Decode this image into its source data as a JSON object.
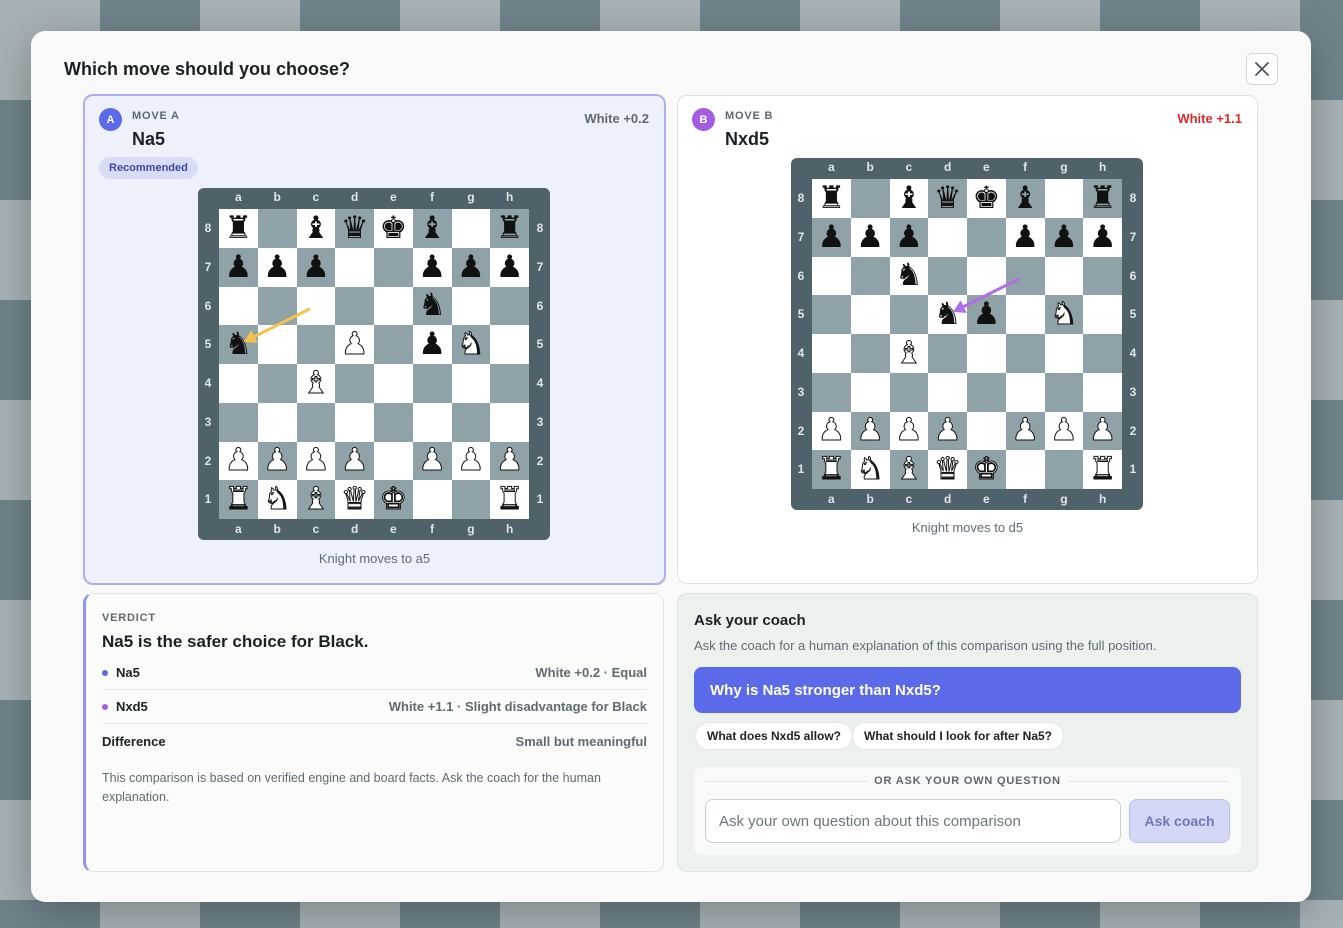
{
  "modal": {
    "title": "Which move should you choose?"
  },
  "colors": {
    "accent": "#5b6ae8",
    "move_a": "#5b6ae8",
    "move_b": "#a45ce0",
    "eval_b": "#d62b2b",
    "arrow_a": "#f5c24a",
    "arrow_b": "#b06ee8"
  },
  "move_a": {
    "badge": "A",
    "kicker": "MOVE A",
    "name": "Na5",
    "eval": "White +0.2",
    "tag": "Recommended",
    "caption": "Knight moves to a5",
    "position": [
      "r.bqkb.r",
      "ppp..ppp",
      ".....n..",
      "n..P.pN.",
      "..B.....",
      "........",
      "PPPP.PPP",
      "RNBQK..R"
    ],
    "arrow": {
      "from": "c6",
      "to": "a5"
    }
  },
  "move_b": {
    "badge": "B",
    "kicker": "MOVE B",
    "name": "Nxd5",
    "eval": "White +1.1",
    "caption": "Knight moves to d5",
    "position": [
      "r.bqkb.r",
      "ppp..ppp",
      "..n.....",
      "...np.N.",
      "..B.....",
      "........",
      "PPPP.PPP",
      "RNBQK..R"
    ],
    "arrow": {
      "from": "f6",
      "to": "d5"
    }
  },
  "files": [
    "a",
    "b",
    "c",
    "d",
    "e",
    "f",
    "g",
    "h"
  ],
  "ranks": [
    "8",
    "7",
    "6",
    "5",
    "4",
    "3",
    "2",
    "1"
  ],
  "verdict": {
    "kicker": "VERDICT",
    "headline": "Na5 is the safer choice for Black.",
    "rows": [
      {
        "label": "Na5",
        "value": "White +0.2 · Equal"
      },
      {
        "label": "Nxd5",
        "value": "White +1.1 · Slight disadvantage for Black"
      },
      {
        "label": "Difference",
        "value": "Small but meaningful"
      }
    ],
    "note": "This comparison is based on verified engine and board facts. Ask the coach for the human explanation."
  },
  "coach": {
    "title": "Ask your coach",
    "subtitle": "Ask the coach for a human explanation of this comparison using the full position.",
    "primary_question": "Why is Na5 stronger than Nxd5?",
    "chips": [
      "What does Nxd5 allow?",
      "What should I look for after Na5?"
    ],
    "own_question_label": "OR ASK YOUR OWN QUESTION",
    "input_placeholder": "Ask your own question about this comparison",
    "button_label": "Ask coach"
  }
}
